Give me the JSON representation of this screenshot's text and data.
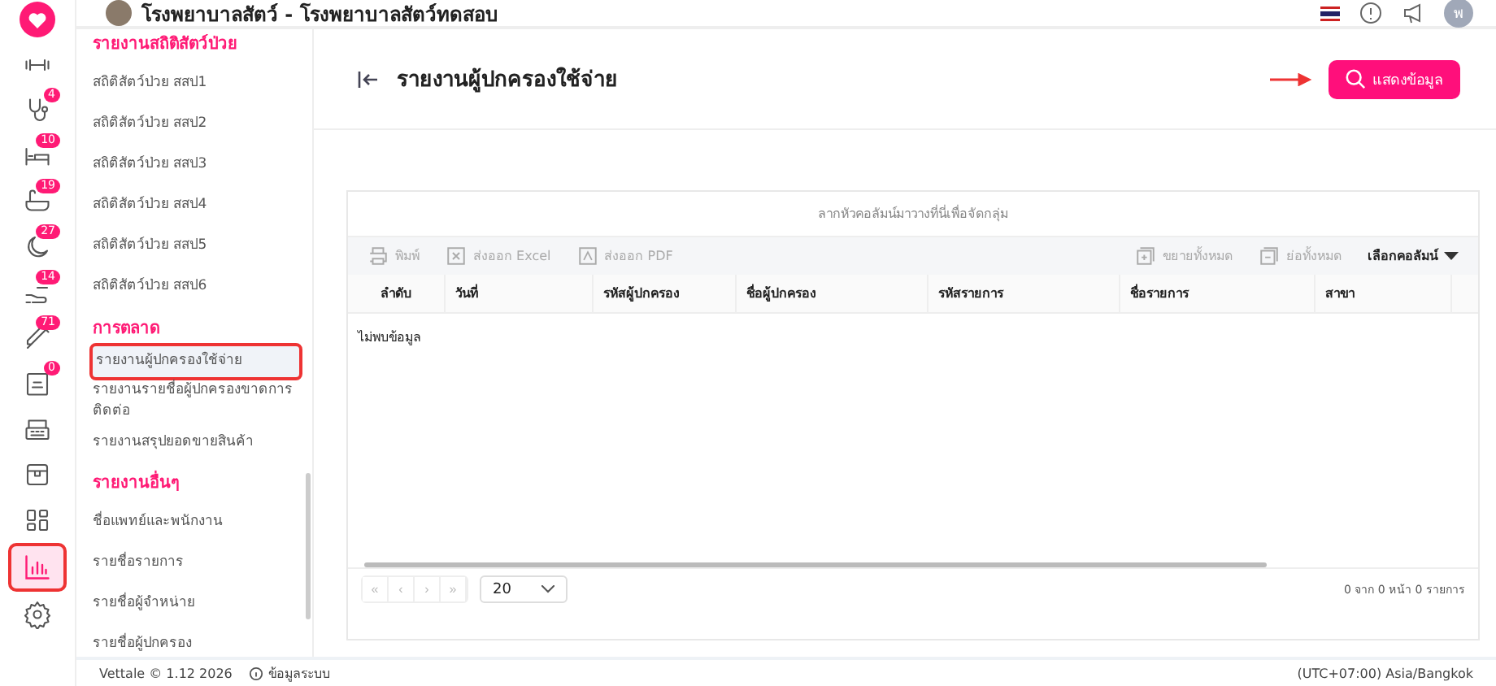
{
  "header": {
    "title": "โรงพยาบาลสัตว์ - โรงพยาบาลสัตว์ทดสอบ",
    "avatar_letter": "พ"
  },
  "rail": [
    {
      "selected": false
    },
    {
      "selected": false
    },
    {
      "badge": "4",
      "selected": false
    },
    {
      "badge": "10",
      "selected": false
    },
    {
      "badge": "19",
      "selected": false
    },
    {
      "badge": "27",
      "selected": false
    },
    {
      "badge": "14",
      "selected": false
    },
    {
      "badge": "71",
      "selected": false
    },
    {
      "badge": "0",
      "selected": false
    },
    {
      "selected": false
    },
    {
      "selected": false
    },
    {
      "selected": false
    },
    {
      "selected": true
    },
    {
      "selected": false
    }
  ],
  "sidebar": [
    {
      "kind": "heading",
      "label": "รายงานสถิติสัตว์ป่วย"
    },
    {
      "kind": "item",
      "label": "สถิติสัตว์ป่วย สสป1",
      "selected": false
    },
    {
      "kind": "item",
      "label": "สถิติสัตว์ป่วย สสป2",
      "selected": false
    },
    {
      "kind": "item",
      "label": "สถิติสัตว์ป่วย สสป3",
      "selected": false
    },
    {
      "kind": "item",
      "label": "สถิติสัตว์ป่วย สสป4",
      "selected": false
    },
    {
      "kind": "item",
      "label": "สถิติสัตว์ป่วย สสป5",
      "selected": false
    },
    {
      "kind": "item",
      "label": "สถิติสัตว์ป่วย สสป6",
      "selected": false
    },
    {
      "kind": "heading",
      "label": "การตลาด"
    },
    {
      "kind": "subitem",
      "label": "รายงานผู้ปกครองใช้จ่าย",
      "selected": true
    },
    {
      "kind": "subitem",
      "label": "รายงานรายชื่อผู้ปกครองขาดการติดต่อ",
      "selected": false
    },
    {
      "kind": "subitem",
      "label": "รายงานสรุปยอดขายสินค้า",
      "selected": false
    },
    {
      "kind": "heading",
      "label": "รายงานอื่นๆ"
    },
    {
      "kind": "item",
      "label": "ชื่อแพทย์และพนักงาน",
      "selected": false
    },
    {
      "kind": "item",
      "label": "รายชื่อรายการ",
      "selected": false
    },
    {
      "kind": "item",
      "label": "รายชื่อผู้จำหน่าย",
      "selected": false
    },
    {
      "kind": "item",
      "label": "รายชื่อผู้ปกครอง",
      "selected": false
    }
  ],
  "page": {
    "title": "รายงานผู้ปกครองใช้จ่าย",
    "show_button": "แสดงข้อมูล"
  },
  "table": {
    "group_hint": "ลากหัวคอลัมน์มาวางที่นี่เพื่อจัดกลุ่ม",
    "toolbar_left": [
      "พิมพ์",
      "ส่งออก Excel",
      "ส่งออก PDF"
    ],
    "toolbar_right": [
      "ขยายทั้งหมด",
      "ย่อทั้งหมด"
    ],
    "column_chooser": "เลือกคอลัมน์",
    "columns": [
      "ลำดับ",
      "วันที่",
      "รหัสผู้ปกครอง",
      "ชื่อผู้ปกครอง",
      "รหัสรายการ",
      "ชื่อรายการ",
      "สาขา"
    ],
    "empty_text": "ไม่พบข้อมูล",
    "pager": [
      "«",
      "‹",
      "›",
      "»"
    ],
    "page_size": "20",
    "summary": "0 จาก 0 หน้า 0 รายการ"
  },
  "footer": {
    "version": "Vettale © 1.12 2026",
    "system_info": "ข้อมูลระบบ",
    "timezone": "(UTC+07:00) Asia/Bangkok"
  }
}
